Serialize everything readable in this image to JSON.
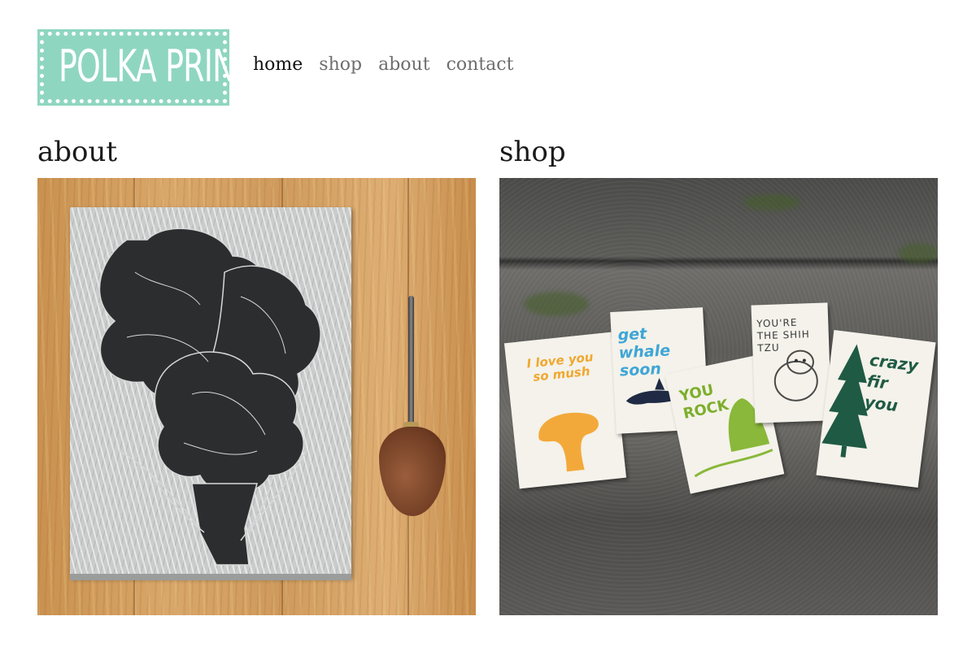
{
  "header": {
    "logo_text": "POLKA PRINTS",
    "nav": [
      {
        "label": "home",
        "active": true
      },
      {
        "label": "shop",
        "active": false
      },
      {
        "label": "about",
        "active": false
      },
      {
        "label": "contact",
        "active": false
      }
    ]
  },
  "sections": {
    "about": {
      "title": "about"
    },
    "shop": {
      "title": "shop"
    }
  },
  "cards": {
    "love": "I love you so mush",
    "whale": "get whale soon",
    "rock": "YOU ROCK",
    "shihtzu": "YOU'RE THE SHIH TZU",
    "fir": "crazy fir you"
  },
  "colors": {
    "logo": "#8fd6c0",
    "nav_active": "#111111",
    "nav_inactive": "#6e6e6e"
  }
}
